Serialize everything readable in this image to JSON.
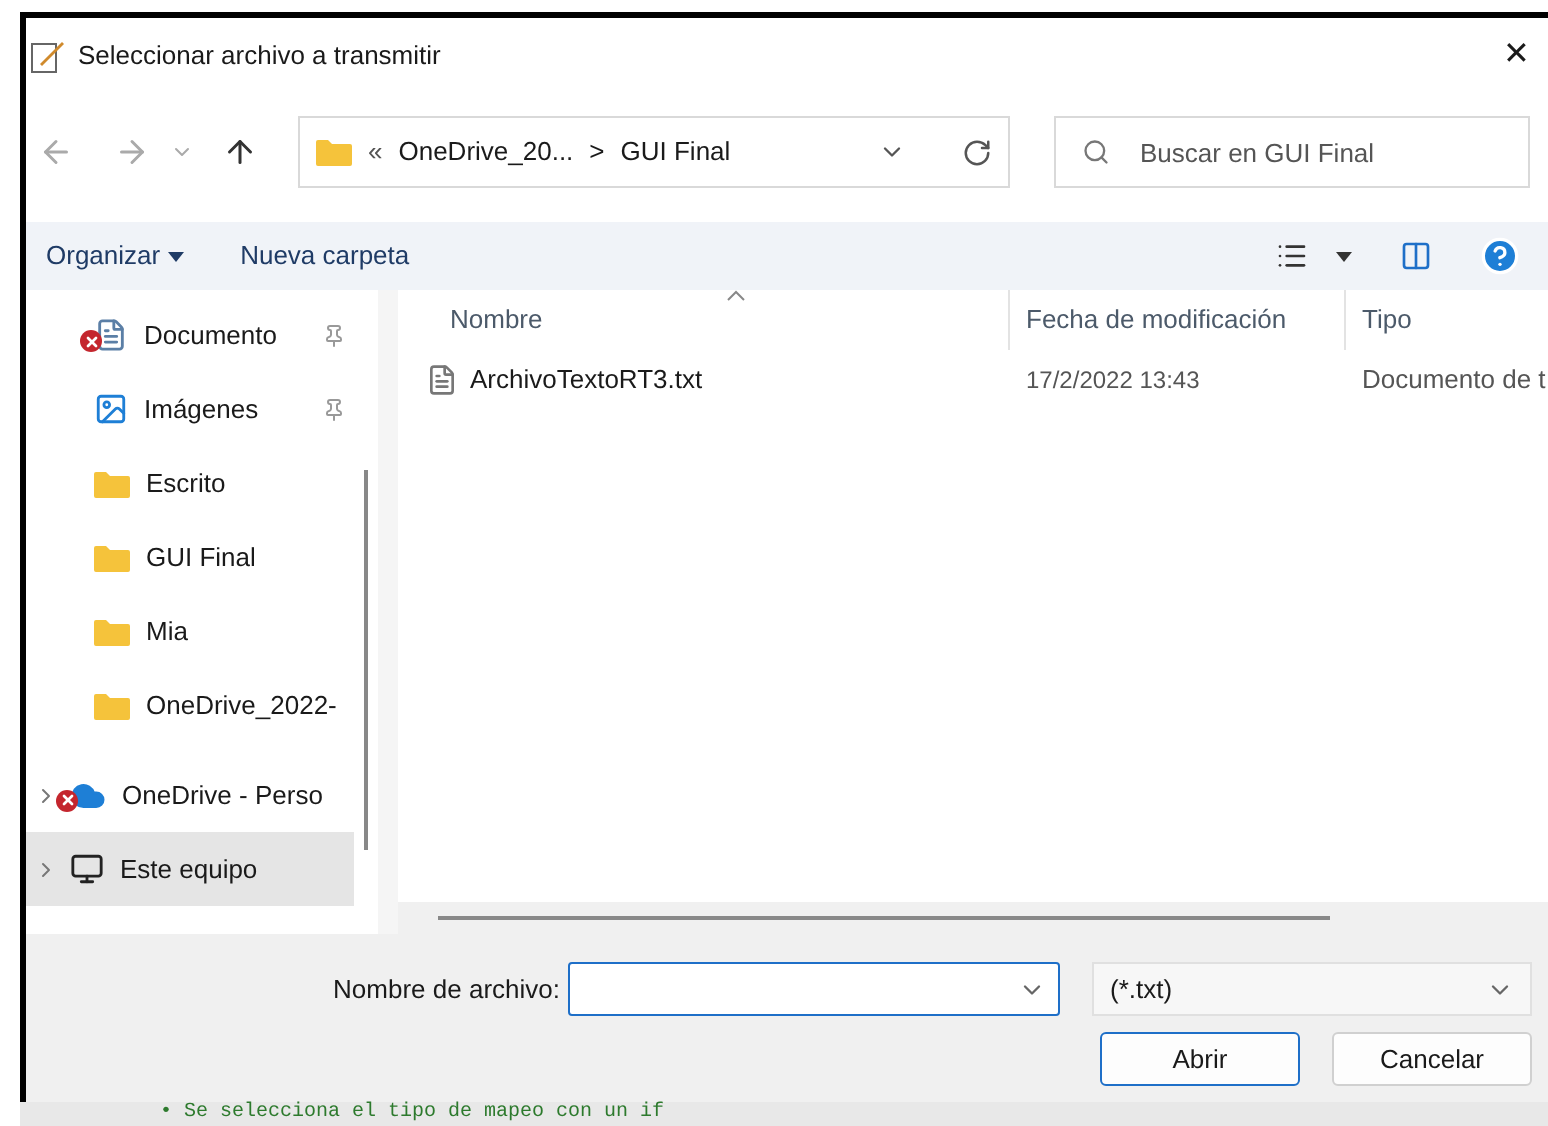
{
  "window": {
    "title": "Seleccionar archivo a transmitir",
    "close": "✕"
  },
  "address": {
    "crumbs_prefix": "«",
    "crumbs": [
      "OneDrive_20...",
      "GUI Final"
    ],
    "separator": ">"
  },
  "search": {
    "placeholder": "Buscar en GUI Final"
  },
  "toolbar": {
    "organize": "Organizar",
    "new_folder": "Nueva carpeta"
  },
  "sidebar": {
    "items": [
      {
        "kind": "documents",
        "label": "Documento",
        "pinned": true,
        "error": true,
        "expandable": false,
        "selected": false
      },
      {
        "kind": "images",
        "label": "Imágenes",
        "pinned": true,
        "error": false,
        "expandable": false,
        "selected": false
      },
      {
        "kind": "folder",
        "label": "Escrito",
        "pinned": false,
        "error": false,
        "expandable": false,
        "selected": false
      },
      {
        "kind": "folder",
        "label": "GUI Final",
        "pinned": false,
        "error": false,
        "expandable": false,
        "selected": false
      },
      {
        "kind": "folder",
        "label": "Mia",
        "pinned": false,
        "error": false,
        "expandable": false,
        "selected": false
      },
      {
        "kind": "folder",
        "label": "OneDrive_2022-",
        "pinned": false,
        "error": false,
        "expandable": false,
        "selected": false
      },
      {
        "kind": "cloud",
        "label": "OneDrive - Perso",
        "pinned": false,
        "error": true,
        "expandable": true,
        "selected": false
      },
      {
        "kind": "pc",
        "label": "Este equipo",
        "pinned": false,
        "error": false,
        "expandable": true,
        "selected": true
      }
    ]
  },
  "table": {
    "columns": [
      "Nombre",
      "Fecha de modificación",
      "Tipo"
    ],
    "rows": [
      {
        "cells": [
          "ArchivoTextoRT3.txt",
          "17/2/2022 13:43",
          "Documento de t"
        ]
      }
    ]
  },
  "file_name": {
    "label": "Nombre de archivo:"
  },
  "file_type": {
    "value": "(*.txt)"
  },
  "buttons": [
    {
      "label": "Abrir",
      "default": true
    },
    {
      "label": "Cancelar",
      "default": false
    }
  ],
  "background_code": "• Se selecciona el tipo de mapeo con un if"
}
